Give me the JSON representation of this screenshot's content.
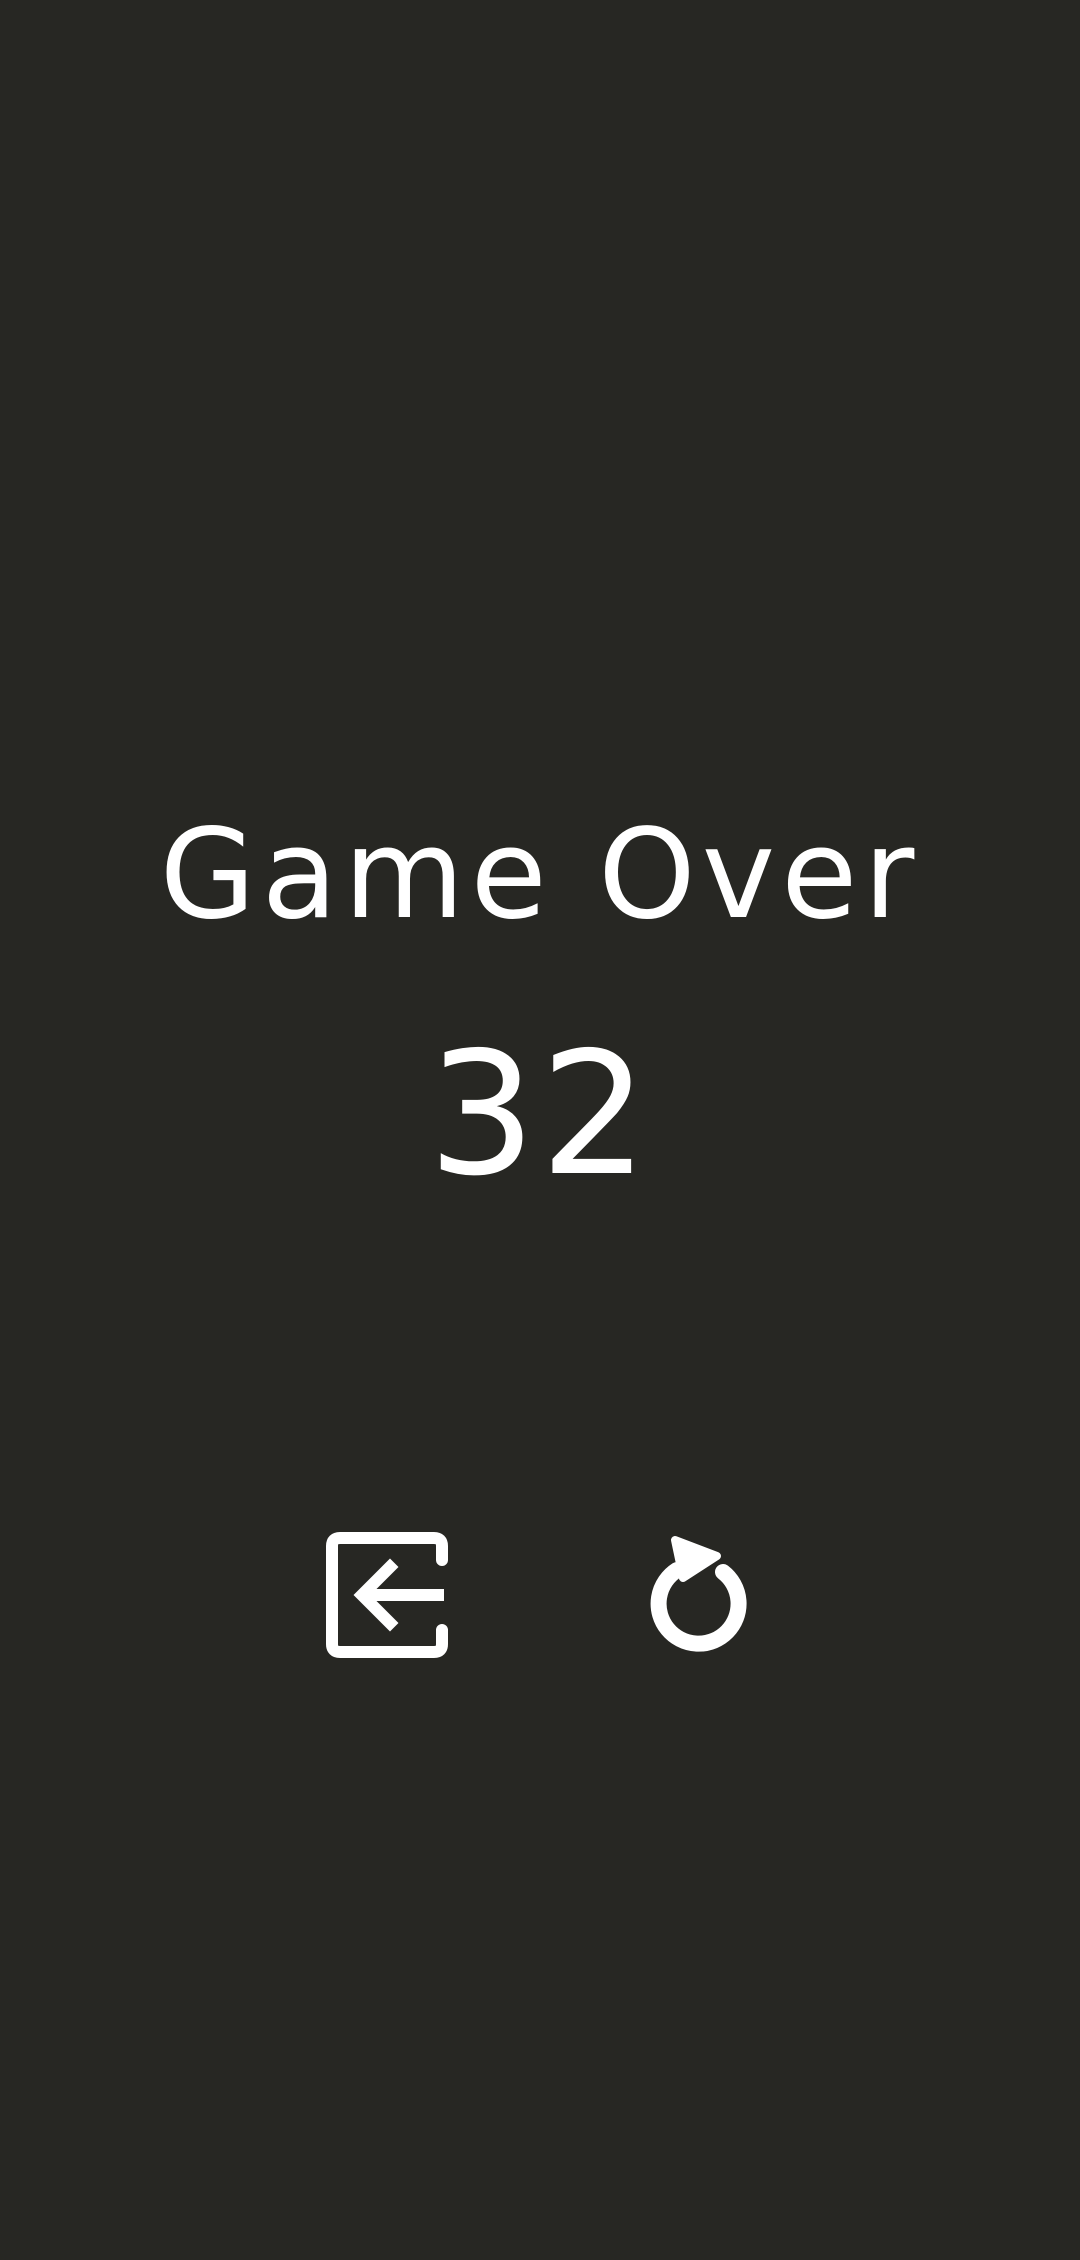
{
  "game_over": {
    "title": "Game Over",
    "score": "32"
  },
  "actions": {
    "exit_icon": "exit-arrow-left-icon",
    "restart_icon": "restart-circular-arrow-icon"
  },
  "colors": {
    "background": "#272723",
    "foreground": "#ffffff"
  }
}
